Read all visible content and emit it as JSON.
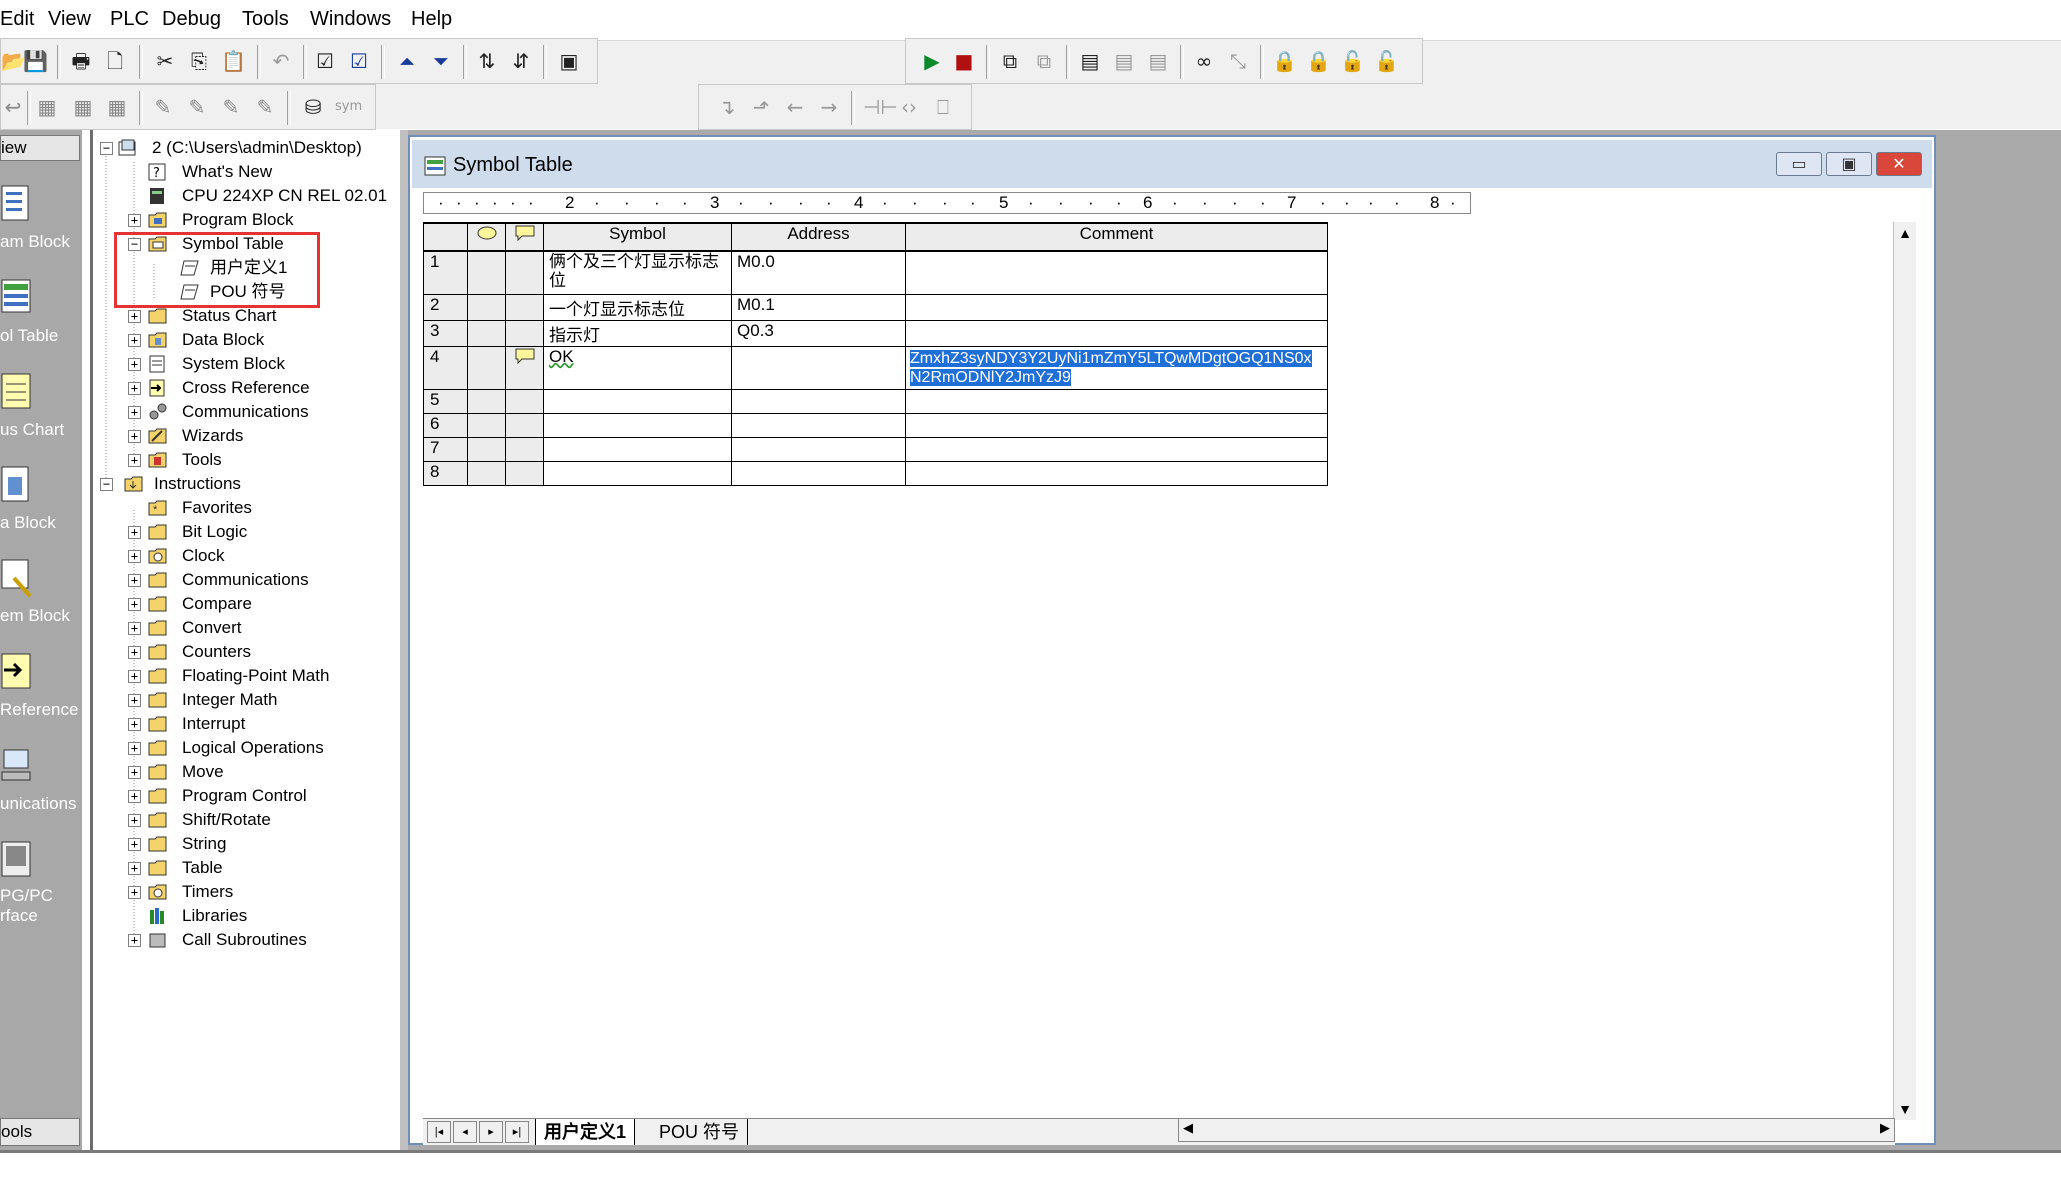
{
  "menu": {
    "items": [
      "Edit",
      "View",
      "PLC",
      "Debug",
      "Tools",
      "Windows",
      "Help"
    ]
  },
  "nav": {
    "header": "iew",
    "items": [
      {
        "label": "am Block",
        "icon": "program-block-icon"
      },
      {
        "label": "ol Table",
        "icon": "symbol-table-icon"
      },
      {
        "label": "us Chart",
        "icon": "status-chart-icon"
      },
      {
        "label": "a Block",
        "icon": "data-block-icon"
      },
      {
        "label": "em Block",
        "icon": "system-block-icon"
      },
      {
        "label": "Reference",
        "icon": "cross-reference-icon"
      },
      {
        "label": "unications",
        "icon": "communications-icon"
      },
      {
        "label": "PG/PC",
        "label2": "rface",
        "icon": "pg-pc-interface-icon"
      }
    ],
    "footer": "ools"
  },
  "tree": {
    "project": "2 (C:\\Users\\admin\\Desktop)",
    "whats_new": "What's New",
    "cpu": "CPU 224XP CN REL 02.01",
    "program_block": "Program Block",
    "symbol_table": "Symbol Table",
    "user_defined": "用户定义1",
    "pou_symbols": "POU 符号",
    "status_chart": "Status Chart",
    "data_block": "Data Block",
    "system_block": "System Block",
    "cross_reference": "Cross Reference",
    "communications": "Communications",
    "wizards": "Wizards",
    "tools": "Tools",
    "instructions": "Instructions",
    "instr": [
      "Favorites",
      "Bit Logic",
      "Clock",
      "Communications",
      "Compare",
      "Convert",
      "Counters",
      "Floating-Point Math",
      "Integer Math",
      "Interrupt",
      "Logical Operations",
      "Move",
      "Program Control",
      "Shift/Rotate",
      "String",
      "Table",
      "Timers",
      "Libraries",
      "Call Subroutines"
    ]
  },
  "window": {
    "title": "Symbol Table",
    "min": "▭",
    "max": "▣",
    "close": "✕"
  },
  "ruler": {
    "marks": [
      "2",
      "3",
      "4",
      "5",
      "6",
      "7",
      "8"
    ]
  },
  "table": {
    "headers": {
      "symbol": "Symbol",
      "address": "Address",
      "comment": "Comment"
    },
    "rows": [
      {
        "n": "1",
        "symbol": "俩个及三个灯显示标志",
        "symbol2": "位",
        "address": "M0.0",
        "comment": ""
      },
      {
        "n": "2",
        "symbol": "一个灯显示标志位",
        "address": "M0.1",
        "comment": ""
      },
      {
        "n": "3",
        "symbol": "指示灯",
        "address": "Q0.3",
        "comment": ""
      },
      {
        "n": "4",
        "symbol": "OK",
        "address": "",
        "comment": "ZmxhZ3syNDY3Y2UyNi1mZmY5LTQwMDgtOGQ1NS0x",
        "comment2": "N2RmODNlY2JmYzJ9"
      },
      {
        "n": "5",
        "symbol": "",
        "address": "",
        "comment": ""
      },
      {
        "n": "6",
        "symbol": "",
        "address": "",
        "comment": ""
      },
      {
        "n": "7",
        "symbol": "",
        "address": "",
        "comment": ""
      },
      {
        "n": "8",
        "symbol": "",
        "address": "",
        "comment": ""
      }
    ]
  },
  "tabs": {
    "active": "用户定义1",
    "other": "POU 符号"
  },
  "nav_arrows": {
    "first": "|◂",
    "prev": "◂",
    "next": "▸",
    "last": "▸|"
  }
}
